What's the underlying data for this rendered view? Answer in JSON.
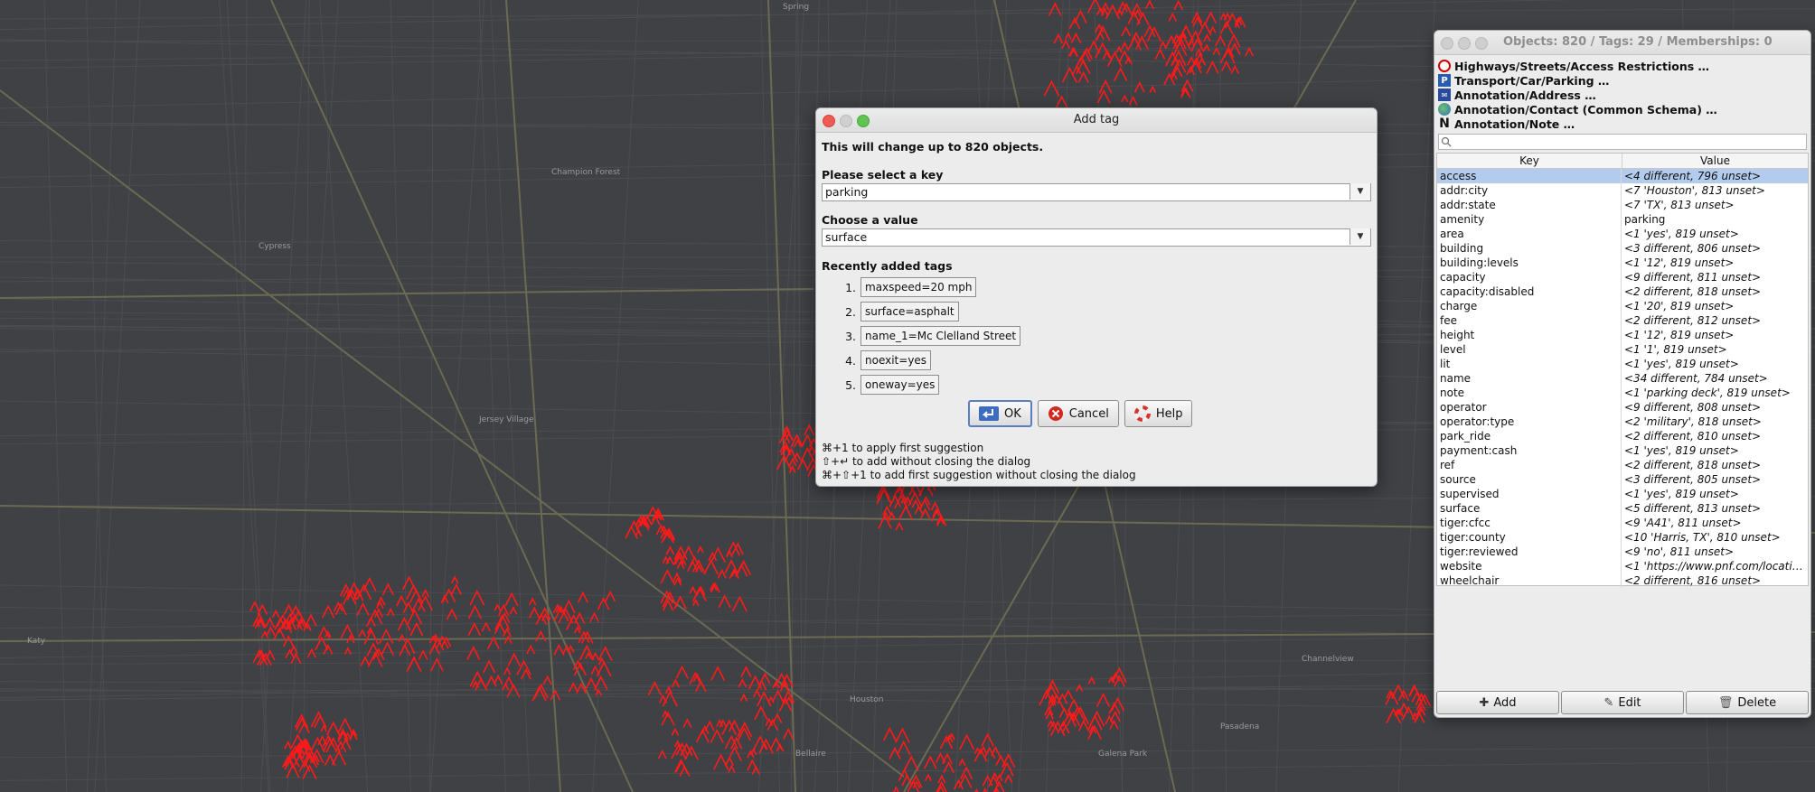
{
  "map": {
    "labels": [
      "Spring",
      "Cypress",
      "Champion Forest",
      "Jersey Village",
      "Katy",
      "Houston",
      "Bellaire",
      "Pasadena",
      "Galena Park",
      "Channelview"
    ]
  },
  "dialog": {
    "title": "Add tag",
    "info": "This will change up to 820 objects.",
    "key_label": "Please select a key",
    "key_value": "parking",
    "value_label": "Choose a value",
    "value_value": "surface",
    "recent_label": "Recently added tags",
    "recent": [
      {
        "num": "1.",
        "tag": "maxspeed=20 mph"
      },
      {
        "num": "2.",
        "tag": "surface=asphalt"
      },
      {
        "num": "3.",
        "tag": "name_1=Mc Clelland Street"
      },
      {
        "num": "4.",
        "tag": "noexit=yes"
      },
      {
        "num": "5.",
        "tag": "oneway=yes"
      }
    ],
    "ok": "OK",
    "cancel": "Cancel",
    "help": "Help",
    "hints": [
      "⌘+1 to apply first suggestion",
      "⇧+↵ to add without closing the dialog",
      "⌘+⇧+1 to add first suggestion without closing the dialog"
    ]
  },
  "panel": {
    "title": "Objects: 820 / Tags: 29 / Memberships: 0",
    "presets": [
      {
        "label": "Highways/Streets/Access Restrictions …",
        "icon": "no-entry-icon",
        "color": "#cc0000"
      },
      {
        "label": "Transport/Car/Parking …",
        "icon": "parking-icon",
        "color": "#2a5db0"
      },
      {
        "label": "Annotation/Address …",
        "icon": "address-icon",
        "color": "#2a4a9a"
      },
      {
        "label": "Annotation/Contact (Common Schema) …",
        "icon": "globe-icon",
        "color": "#2f8a3a"
      },
      {
        "label": "Annotation/Note …",
        "icon": "note-icon",
        "color": "#111111"
      }
    ],
    "col_key": "Key",
    "col_value": "Value",
    "rows": [
      {
        "k": "access",
        "v": "<4 different, 796 unset>",
        "m": true
      },
      {
        "k": "addr:city",
        "v": "<7 'Houston', 813 unset>",
        "m": true
      },
      {
        "k": "addr:state",
        "v": "<7 'TX', 813 unset>",
        "m": true
      },
      {
        "k": "amenity",
        "v": "parking",
        "m": false
      },
      {
        "k": "area",
        "v": "<1 'yes', 819 unset>",
        "m": true
      },
      {
        "k": "building",
        "v": "<3 different, 806 unset>",
        "m": true
      },
      {
        "k": "building:levels",
        "v": "<1 '12', 819 unset>",
        "m": true
      },
      {
        "k": "capacity",
        "v": "<9 different, 811 unset>",
        "m": true
      },
      {
        "k": "capacity:disabled",
        "v": "<2 different, 818 unset>",
        "m": true
      },
      {
        "k": "charge",
        "v": "<1 '20', 819 unset>",
        "m": true
      },
      {
        "k": "fee",
        "v": "<2 different, 812 unset>",
        "m": true
      },
      {
        "k": "height",
        "v": "<1 '12', 819 unset>",
        "m": true
      },
      {
        "k": "level",
        "v": "<1 '1', 819 unset>",
        "m": true
      },
      {
        "k": "lit",
        "v": "<1 'yes', 819 unset>",
        "m": true
      },
      {
        "k": "name",
        "v": "<34 different, 784 unset>",
        "m": true
      },
      {
        "k": "note",
        "v": "<1 'parking deck', 819 unset>",
        "m": true
      },
      {
        "k": "operator",
        "v": "<9 different, 808 unset>",
        "m": true
      },
      {
        "k": "operator:type",
        "v": "<2 'military', 818 unset>",
        "m": true
      },
      {
        "k": "park_ride",
        "v": "<2 different, 810 unset>",
        "m": true
      },
      {
        "k": "payment:cash",
        "v": "<1 'yes', 819 unset>",
        "m": true
      },
      {
        "k": "ref",
        "v": "<2 different, 818 unset>",
        "m": true
      },
      {
        "k": "source",
        "v": "<3 different, 805 unset>",
        "m": true
      },
      {
        "k": "supervised",
        "v": "<1 'yes', 819 unset>",
        "m": true
      },
      {
        "k": "surface",
        "v": "<5 different, 813 unset>",
        "m": true
      },
      {
        "k": "tiger:cfcc",
        "v": "<9 'A41', 811 unset>",
        "m": true
      },
      {
        "k": "tiger:county",
        "v": "<10 'Harris, TX', 810 unset>",
        "m": true
      },
      {
        "k": "tiger:reviewed",
        "v": "<9 'no', 811 unset>",
        "m": true
      },
      {
        "k": "website",
        "v": "<1 'https://www.pnf.com/locati…",
        "m": true
      },
      {
        "k": "wheelchair",
        "v": "<2 different, 816 unset>",
        "m": true
      }
    ],
    "add": "Add",
    "edit": "Edit",
    "delete": "Delete"
  }
}
